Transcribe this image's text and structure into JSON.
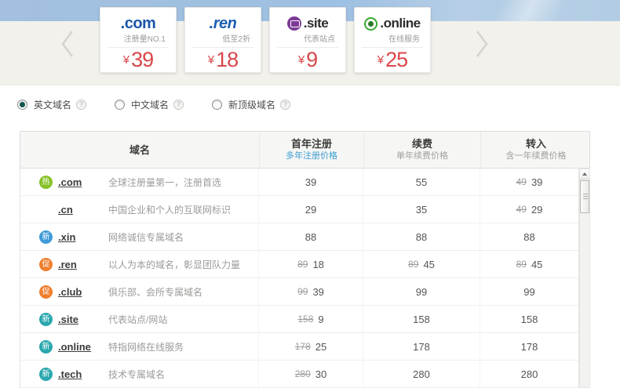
{
  "icons": {
    "help": "?",
    "prev_arrow": "chevron-left",
    "next_arrow": "chevron-right",
    "site_badge": "site-logo-bubble",
    "online_badge": "online-logo-ring",
    "scroll_up": "triangle-up"
  },
  "hero": {
    "currency": "¥",
    "cards": [
      {
        "tld": ".com",
        "tagline": "注册量NO.1",
        "price": "39",
        "brand_color": "#1a56a8",
        "style": "bold"
      },
      {
        "tld": ".ren",
        "tagline": "低至2折",
        "price": "18",
        "brand_color": "#1c5fb4",
        "style": "bold-italic"
      },
      {
        "tld": ".site",
        "tagline": "代表站点",
        "price": "9",
        "brand_color": "#2b2b2b",
        "style": "bold",
        "badge_icon": "site-badge-icon",
        "badge_color": "#7c3a96"
      },
      {
        "tld": ".online",
        "tagline": "在线服务",
        "price": "25",
        "brand_color": "#2b2b2b",
        "style": "bold",
        "badge_icon": "online-badge-icon",
        "badge_color": "#3aaa35"
      }
    ]
  },
  "filters": {
    "options": [
      {
        "label": "英文域名",
        "selected": true
      },
      {
        "label": "中文域名",
        "selected": false
      },
      {
        "label": "新顶级域名",
        "selected": false
      }
    ]
  },
  "table": {
    "link_color": "#3a9cd0",
    "header": {
      "domain": {
        "title": "域名",
        "subtitle": ""
      },
      "register": {
        "title": "首年注册",
        "subtitle": "多年注册价格"
      },
      "renew": {
        "title": "续费",
        "subtitle": "单年续费价格"
      },
      "transfer": {
        "title": "转入",
        "subtitle": "含一年续费价格"
      }
    },
    "rows": [
      {
        "badge": "热",
        "badge_color": "#85c226",
        "tld": ".com",
        "desc": "全球注册量第一，注册首选",
        "register_old": "",
        "register_now": "39",
        "renew_old": "",
        "renew_now": "55",
        "transfer_old": "49",
        "transfer_now": "39"
      },
      {
        "badge": "",
        "badge_color": "",
        "tld": ".cn",
        "desc": "中国企业和个人的互联网标识",
        "register_old": "",
        "register_now": "29",
        "renew_old": "",
        "renew_now": "35",
        "transfer_old": "49",
        "transfer_now": "29"
      },
      {
        "badge": "新",
        "badge_color": "#3f9bd8",
        "tld": ".xin",
        "desc": "网络诚信专属域名",
        "register_old": "",
        "register_now": "88",
        "renew_old": "",
        "renew_now": "88",
        "transfer_old": "",
        "transfer_now": "88"
      },
      {
        "badge": "促",
        "badge_color": "#f07f2d",
        "tld": ".ren",
        "desc": "以人为本的域名，彰显团队力量",
        "register_old": "89",
        "register_now": "18",
        "renew_old": "89",
        "renew_now": "45",
        "transfer_old": "89",
        "transfer_now": "45"
      },
      {
        "badge": "促",
        "badge_color": "#f07f2d",
        "tld": ".club",
        "desc": "俱乐部、会所专属域名",
        "register_old": "99",
        "register_now": "39",
        "renew_old": "",
        "renew_now": "99",
        "transfer_old": "",
        "transfer_now": "99"
      },
      {
        "badge": "新",
        "badge_color": "#2ba8ae",
        "tld": ".site",
        "desc": "代表站点/网站",
        "register_old": "158",
        "register_now": "9",
        "renew_old": "",
        "renew_now": "158",
        "transfer_old": "",
        "transfer_now": "158"
      },
      {
        "badge": "新",
        "badge_color": "#2ba8ae",
        "tld": ".online",
        "desc": "特指网络在线服务",
        "register_old": "178",
        "register_now": "25",
        "renew_old": "",
        "renew_now": "178",
        "transfer_old": "",
        "transfer_now": "178"
      },
      {
        "badge": "新",
        "badge_color": "#2ba8ae",
        "tld": ".tech",
        "desc": "技术专属域名",
        "register_old": "280",
        "register_now": "30",
        "renew_old": "",
        "renew_now": "280",
        "transfer_old": "",
        "transfer_now": "280"
      }
    ]
  }
}
